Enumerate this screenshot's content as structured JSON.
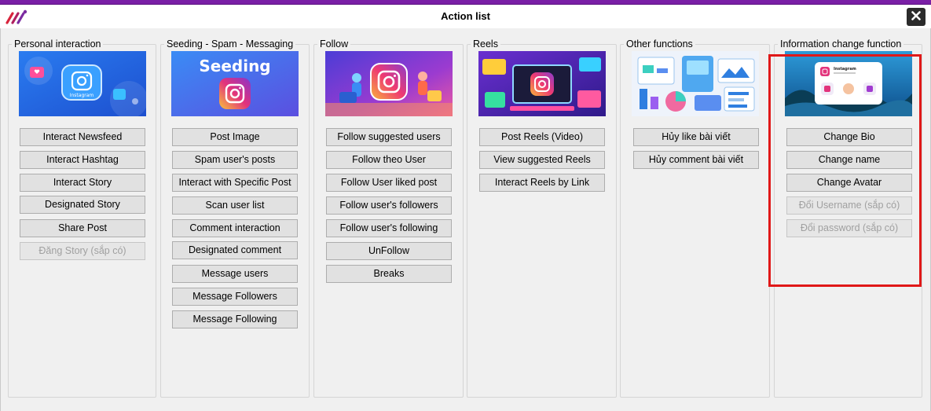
{
  "window": {
    "title": "Action list",
    "logo_icon": "app-logo-icon",
    "close_icon": "close-icon"
  },
  "groups": {
    "personal": {
      "title": "Personal interaction",
      "image_label": "Instagram",
      "buttons": [
        "Interact Newsfeed",
        "Interact Hashtag",
        "Interact Story",
        "Designated Story",
        "Share Post",
        "Đăng Story (sắp có)"
      ]
    },
    "seeding": {
      "title": "Seeding - Spam - Messaging",
      "image_label": "Seeding",
      "buttons": [
        "Post Image",
        "Spam user's posts",
        "Interact with Specific Post",
        "Scan user list",
        "Comment interaction",
        "Designated comment",
        "Message users",
        "Message Followers",
        "Message Following"
      ]
    },
    "follow": {
      "title": "Follow",
      "buttons": [
        "Follow suggested users",
        "Follow theo User",
        "Follow User liked post",
        "Follow user's followers",
        "Follow user's following",
        "UnFollow",
        "Breaks"
      ]
    },
    "reels": {
      "title": "Reels",
      "buttons": [
        "Post Reels (Video)",
        "View suggested Reels",
        "Interact Reels by Link"
      ]
    },
    "other": {
      "title": "Other functions",
      "buttons": [
        "Hủy like bài viết",
        "Hủy comment bài viết"
      ]
    },
    "info": {
      "title": "Information change function",
      "image_label": "Instagram",
      "buttons": [
        "Change Bio",
        "Change name",
        "Change Avatar",
        "Đổi Username (sắp có)",
        "Đổi password (sắp có)"
      ]
    }
  },
  "colors": {
    "top_accent": "#7a1fa6",
    "highlight_border": "#e01818",
    "button_face": "#e1e1e1",
    "disabled_text": "#a0a0a0"
  }
}
